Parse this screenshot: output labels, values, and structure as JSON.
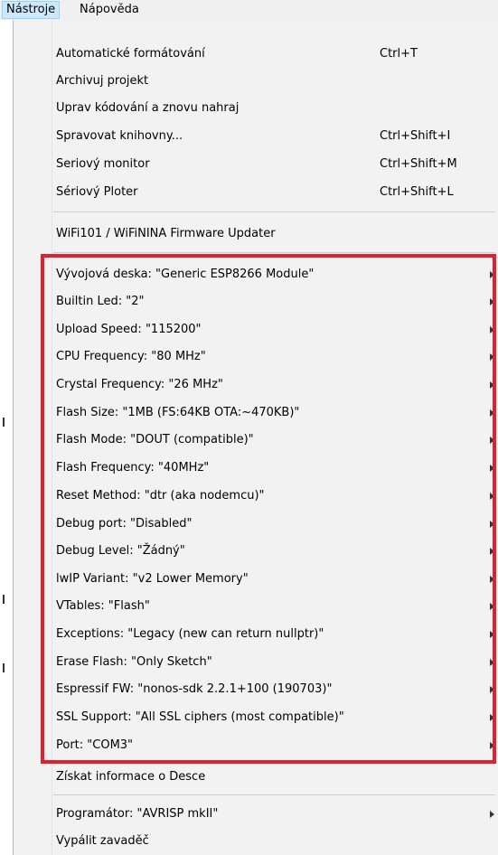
{
  "menubar": {
    "items": [
      "Nástroje",
      "Nápověda"
    ]
  },
  "menu": {
    "group1": [
      {
        "label": "Automatické formátování",
        "shortcut": "Ctrl+T"
      },
      {
        "label": "Archivuj projekt",
        "shortcut": ""
      },
      {
        "label": "Uprav kódování a znovu nahraj",
        "shortcut": ""
      },
      {
        "label": "Spravovat knihovny...",
        "shortcut": "Ctrl+Shift+I"
      },
      {
        "label": "Seriový monitor",
        "shortcut": "Ctrl+Shift+M"
      },
      {
        "label": "Sériový Ploter",
        "shortcut": "Ctrl+Shift+L"
      }
    ],
    "group2": [
      {
        "label": "WiFi101 / WiFiNINA Firmware Updater"
      }
    ],
    "board_items": [
      {
        "label": "Vývojová deska: \"Generic ESP8266 Module\""
      },
      {
        "label": "Builtin Led: \"2\""
      },
      {
        "label": "Upload Speed: \"115200\""
      },
      {
        "label": "CPU Frequency: \"80 MHz\""
      },
      {
        "label": "Crystal Frequency: \"26 MHz\""
      },
      {
        "label": "Flash Size: \"1MB (FS:64KB OTA:~470KB)\""
      },
      {
        "label": "Flash Mode: \"DOUT (compatible)\""
      },
      {
        "label": "Flash Frequency: \"40MHz\""
      },
      {
        "label": "Reset Method: \"dtr (aka nodemcu)\""
      },
      {
        "label": "Debug port: \"Disabled\""
      },
      {
        "label": "Debug Level: \"Žádný\""
      },
      {
        "label": "lwIP Variant: \"v2 Lower Memory\""
      },
      {
        "label": "VTables: \"Flash\""
      },
      {
        "label": "Exceptions: \"Legacy (new can return nullptr)\""
      },
      {
        "label": "Erase Flash: \"Only Sketch\""
      },
      {
        "label": "Espressif FW: \"nonos-sdk 2.2.1+100 (190703)\""
      },
      {
        "label": "SSL Support: \"All SSL ciphers (most compatible)\""
      },
      {
        "label": "Port: \"COM3\""
      }
    ],
    "board_info": {
      "label": "Získat informace o Desce"
    },
    "group4": [
      {
        "label": "Programátor: \"AVRISP mkII\""
      },
      {
        "label": "Vypálit zavaděč"
      }
    ]
  },
  "colors": {
    "highlight_border": "#e41e2b",
    "menu_active": "#cce8ff"
  }
}
